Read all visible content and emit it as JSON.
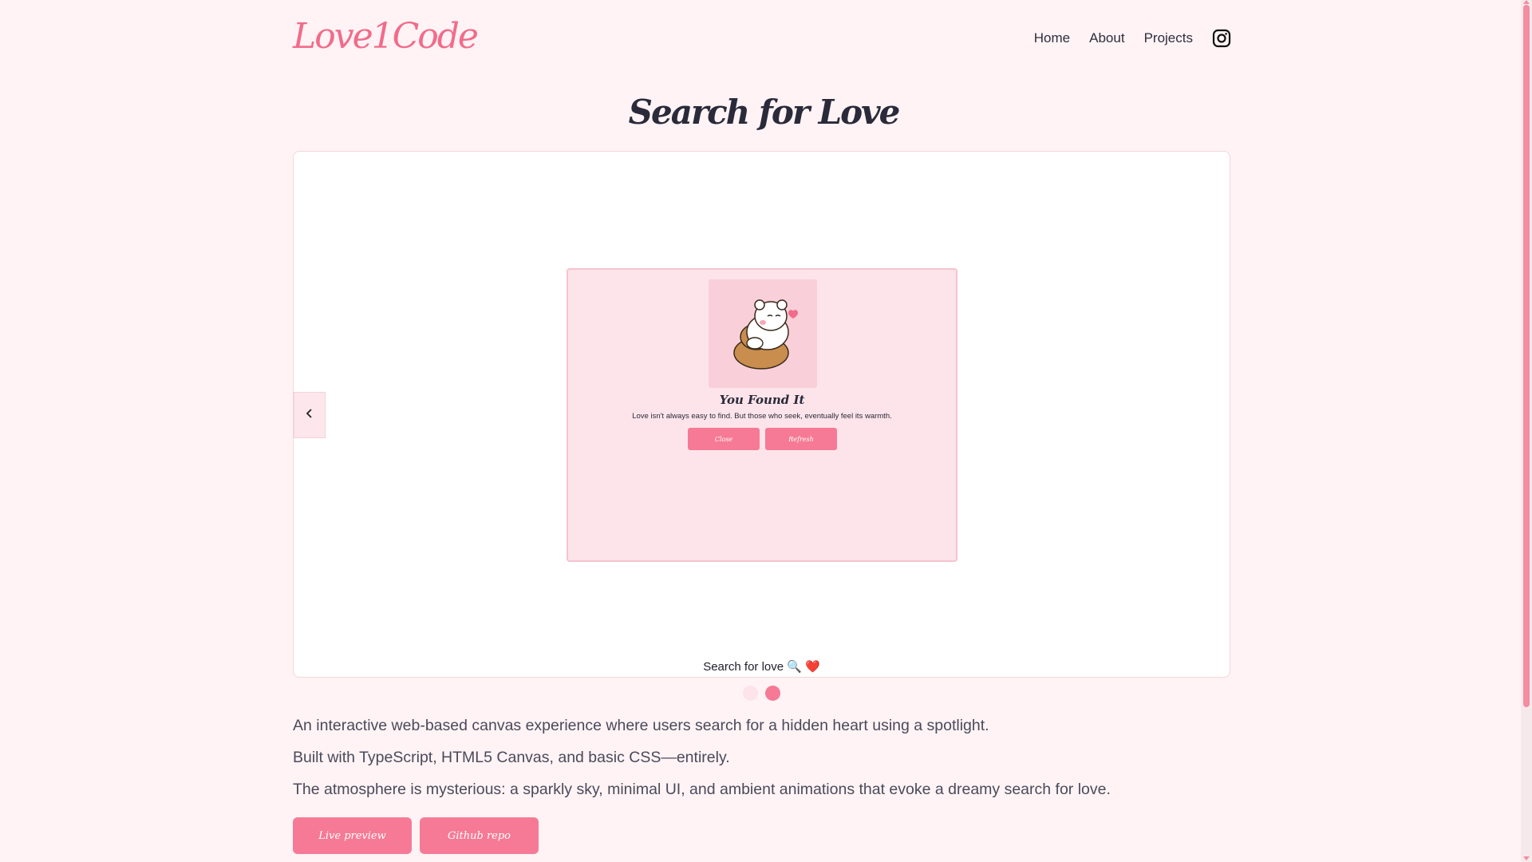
{
  "header": {
    "logo": "Love1Code",
    "nav": [
      "Home",
      "About",
      "Projects"
    ],
    "social_icon": "instagram-icon"
  },
  "page_title": "Search for Love",
  "carousel": {
    "slide": {
      "heading": "You Found It",
      "text": "Love isn't always easy to find. But those who seek, eventually feel its warmth.",
      "buttons": [
        "Close",
        "Refresh"
      ],
      "image": "bear-hug-illustration"
    },
    "caption": "Search for love 🔍 ❤️",
    "prev_icon": "chevron-left-icon",
    "dots": [
      {
        "active": false
      },
      {
        "active": true
      }
    ]
  },
  "description": [
    "An interactive web-based canvas experience where users search for a hidden heart using a spotlight.",
    "Built with TypeScript, HTML5 Canvas, and basic CSS—entirely.",
    "The atmosphere is mysterious: a sparkly sky, minimal UI, and ambient animations that evoke a dreamy search for love."
  ],
  "actions": [
    "Live preview",
    "Github repo"
  ],
  "colors": {
    "accent": "#f67a95",
    "background": "#fff3f5",
    "dot_inactive": "#fde4ea",
    "dot_active": "#f67a95"
  }
}
